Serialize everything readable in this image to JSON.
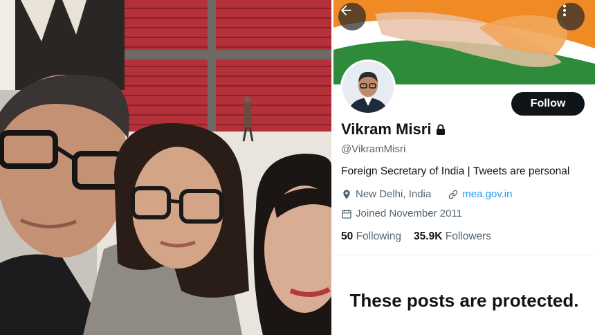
{
  "profile": {
    "display_name": "Vikram Misri",
    "handle": "@VikramMisri",
    "bio": "Foreign Secretary of India | Tweets are personal",
    "location": "New Delhi, India",
    "website": "mea.gov.in",
    "joined": "Joined November 2011",
    "following_count": "50",
    "following_label": "Following",
    "followers_count": "35.9K",
    "followers_label": "Followers",
    "follow_button": "Follow",
    "protected_message": "These posts are protected."
  },
  "icons": {
    "back": "arrow-left-icon",
    "more": "more-vertical-icon",
    "lock": "lock-icon",
    "location": "location-pin-icon",
    "link": "link-icon",
    "calendar": "calendar-icon"
  },
  "colors": {
    "link": "#1d9bf0",
    "secondary_text": "#536471",
    "primary_text": "#0f1419",
    "follow_button_bg": "#0f1419"
  }
}
